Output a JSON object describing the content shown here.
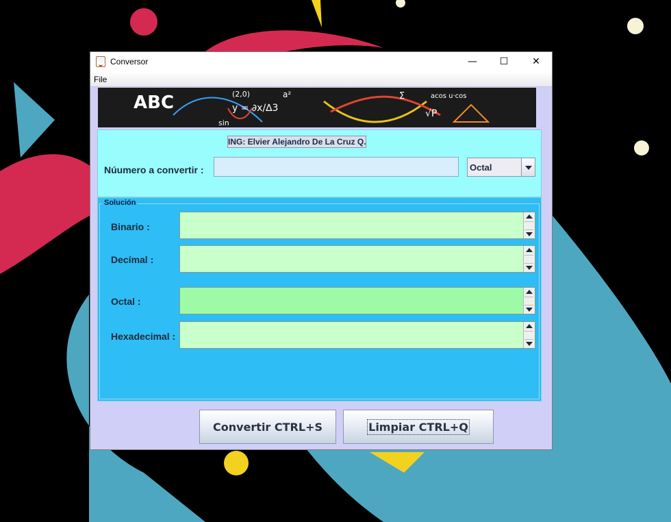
{
  "window": {
    "title": "Conversor",
    "minimize_glyph": "—",
    "maximize_glyph": "☐",
    "close_glyph": "✕"
  },
  "menu": {
    "file": "File"
  },
  "banner": {
    "chalk_text": [
      "ABC",
      "y = ∂x/∆3",
      "(2,0)",
      "Σ",
      "acos u·cos",
      "√P",
      "sin",
      "a²"
    ]
  },
  "input_panel": {
    "author": "ING: Elvier Alejandro De La Cruz Q...",
    "number_label": "Núumero a convertir :",
    "number_value": "",
    "base_selected": "Octal"
  },
  "solution": {
    "legend": "Solución",
    "results": [
      {
        "label": "Binario :",
        "value": ""
      },
      {
        "label": "Decímal :",
        "value": ""
      },
      {
        "label": "Octal :",
        "value": ""
      },
      {
        "label": "Hexadecimal :",
        "value": ""
      }
    ]
  },
  "buttons": {
    "convert": "Convertir CTRL+S",
    "clear": "Limpiar CTRL+Q"
  },
  "colors": {
    "wallpaper": "#000000",
    "window_bg": "#cfcff7",
    "input_panel_bg": "#9afdfd",
    "solution_bg": "#2ebdf4",
    "result_field_bg": "#c9ffca",
    "result_field_focused_bg": "#9ffaa8",
    "banner_bg": "#1b1b1b"
  }
}
